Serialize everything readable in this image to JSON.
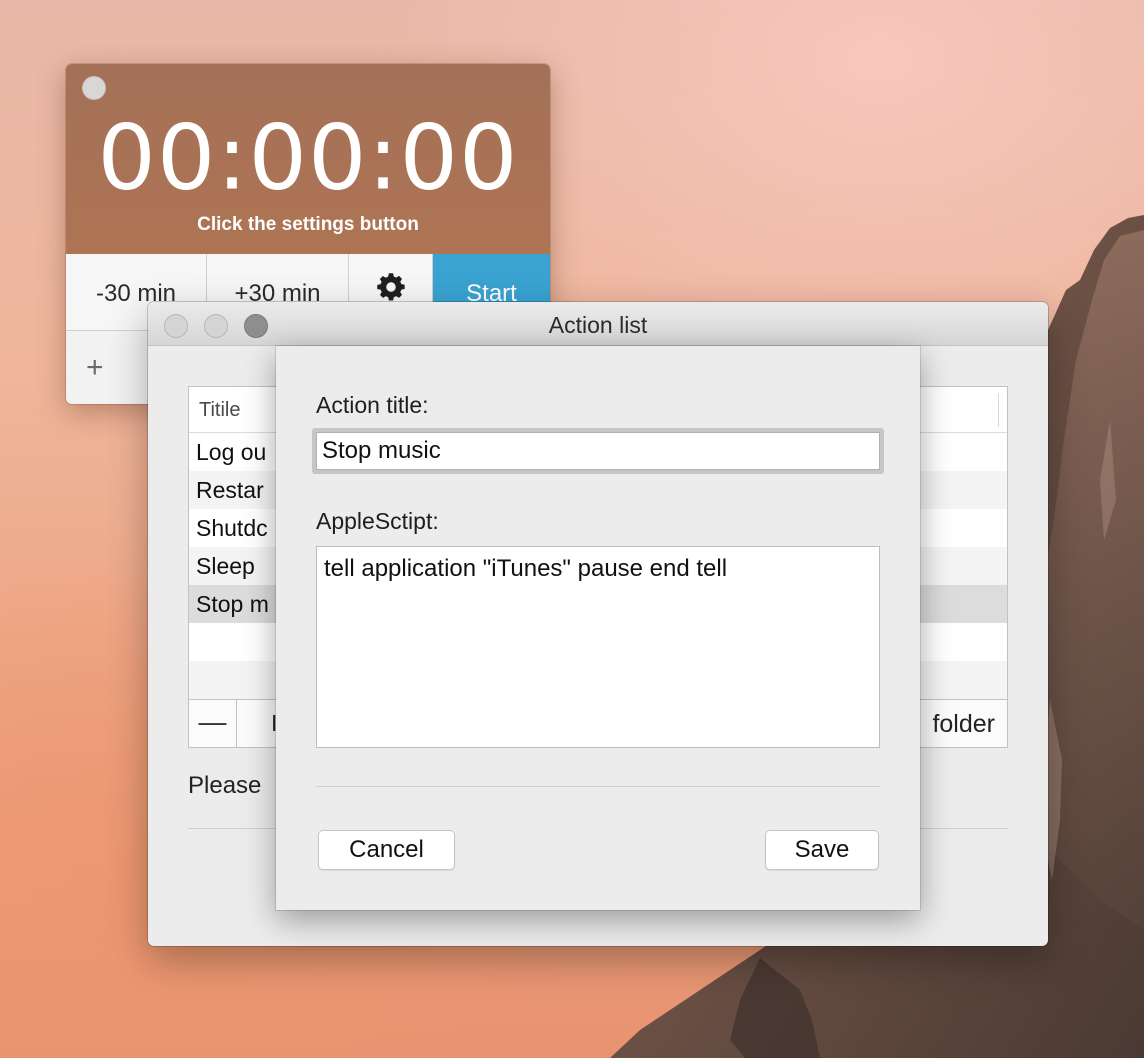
{
  "timer": {
    "display": "00:00:00",
    "hint": "Click the settings button",
    "buttons": {
      "minus": "-30 min",
      "plus": "+30 min",
      "settings_icon": "gear-icon",
      "start": "Start"
    },
    "add_icon": "+",
    "colors": {
      "display_bg": "#a97355",
      "start_bg": "#3aa3d2"
    }
  },
  "window": {
    "title": "Action list",
    "table": {
      "column_header": "Titile",
      "rows": [
        "Log ou",
        "Restar",
        "Shutdc",
        "Sleep",
        "Stop m"
      ],
      "selected_index": 4
    },
    "footer": {
      "remove": "—",
      "second_label": "I",
      "folder_label": "folder"
    },
    "status": "Please"
  },
  "sheet": {
    "title_label": "Action title:",
    "title_value": "Stop music",
    "script_label": "AppleSctipt:",
    "script_value": "tell application \"iTunes\" pause end tell",
    "cancel": "Cancel",
    "save": "Save"
  }
}
